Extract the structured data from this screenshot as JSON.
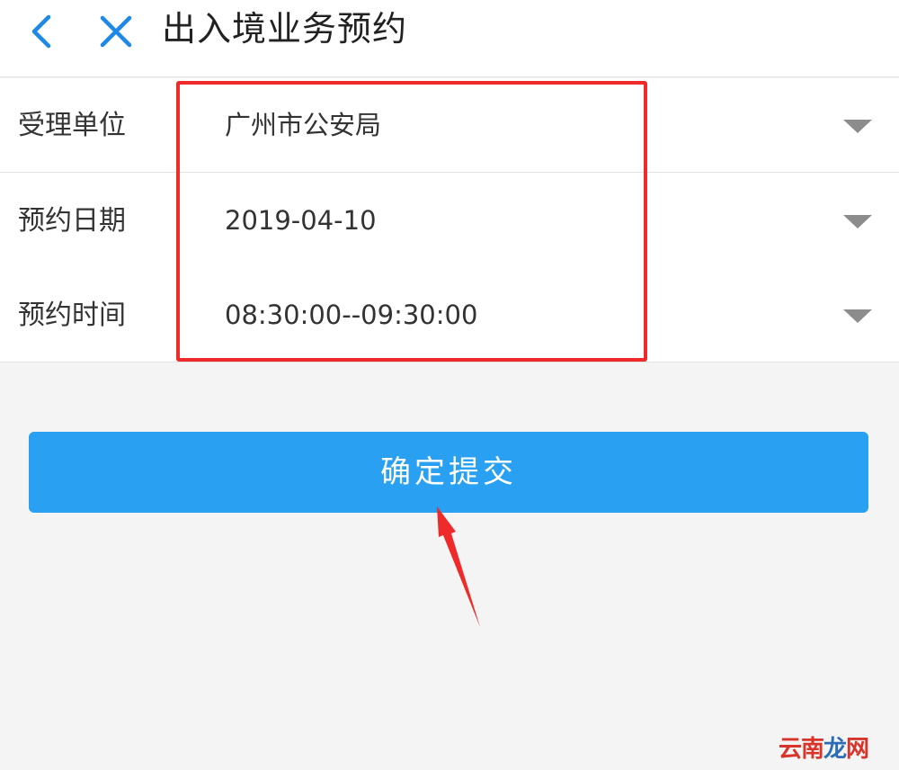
{
  "header": {
    "title": "出入境业务预约",
    "back_icon": "chevron-left-icon",
    "close_icon": "close-icon",
    "icon_color": "#1e88e5"
  },
  "form": {
    "rows": [
      {
        "label": "受理单位",
        "value": "广州市公安局",
        "icon": "caret-down-icon"
      },
      {
        "label": "预约日期",
        "value": "2019-04-10",
        "icon": "caret-down-icon"
      },
      {
        "label": "预约时间",
        "value": "08:30:00--09:30:00",
        "icon": "caret-down-icon"
      }
    ]
  },
  "submit": {
    "label": "确定提交",
    "color": "#2aa0f2"
  },
  "annotations": {
    "highlight_color": "#ee2a2a",
    "arrow_color": "#ee2a2a"
  },
  "watermark": {
    "part1": "云南",
    "part2": "龙",
    "part3": "网"
  }
}
